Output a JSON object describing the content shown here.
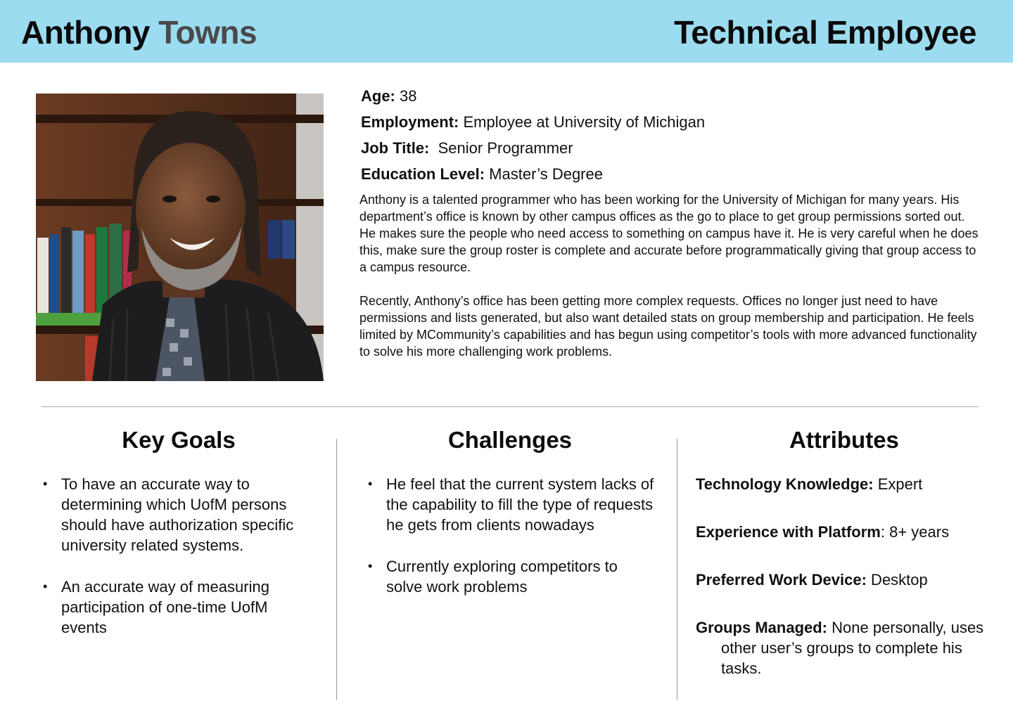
{
  "header": {
    "first_name": "Anthony",
    "last_name": "Towns",
    "role": "Technical Employee",
    "background_color": "#9cdcf0"
  },
  "photo": {
    "icon": "portrait-photo"
  },
  "facts": [
    {
      "label": "Age:",
      "value": "38"
    },
    {
      "label": "Employment:",
      "value": "Employee at University of Michigan"
    },
    {
      "label": "Job Title:",
      "value": " Senior Programmer"
    },
    {
      "label": "Education Level:",
      "value": "Master’s Degree"
    }
  ],
  "bio": [
    "Anthony is a talented programmer who has been working for the University of Michigan for many years. His department’s office is known by other campus offices as the go to place to get group permissions sorted out. He makes sure the people who need access to something on campus have it. He is very careful when he does this, make sure the group roster is complete and accurate before programmatically giving that group access to a campus resource.",
    "Recently, Anthony’s office has been getting more complex requests. Offices no longer just need to have permissions and lists generated, but also want detailed stats on group membership and participation. He feels limited by MCommunity’s capabilities and has begun using competitor’s tools with more advanced functionality to solve his more challenging work problems."
  ],
  "key_goals": {
    "title": "Key Goals",
    "items": [
      "To have an accurate way to determining which UofM persons should have authorization specific university related systems.",
      "An accurate way of measuring participation of one-time UofM events"
    ]
  },
  "challenges": {
    "title": "Challenges",
    "items": [
      "He feel that the current system lacks of the capability to fill the type of requests he gets from clients nowadays",
      "Currently exploring competitors to solve work problems"
    ]
  },
  "attributes": {
    "title": "Attributes",
    "items": [
      {
        "label": "Technology Knowledge:",
        "value": " Expert"
      },
      {
        "label": "Experience with Platform",
        "value": ": 8+ years"
      },
      {
        "label": "Preferred Work Device:",
        "value": " Desktop"
      },
      {
        "label": "Groups Managed:",
        "value": " None personally, uses other user’s groups to complete his tasks."
      }
    ]
  }
}
